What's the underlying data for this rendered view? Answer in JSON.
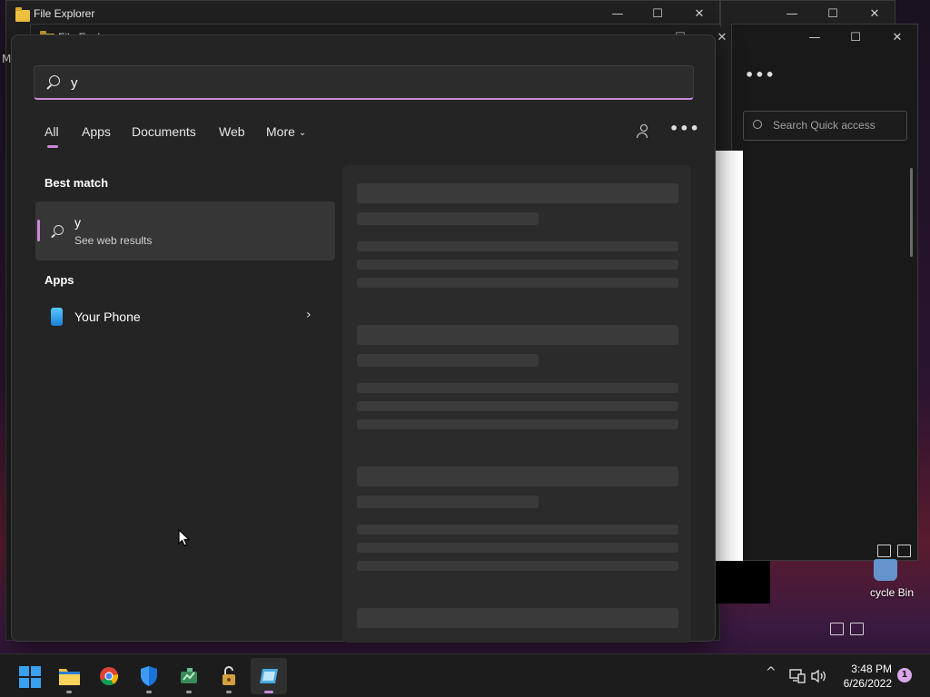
{
  "background": {
    "window1_title": "File Explorer",
    "window2_title": "File Explorer",
    "quick_access_placeholder": "Search Quick access",
    "recycle_bin_label": "cycle Bin",
    "edge_letter": "M"
  },
  "search": {
    "query": "y"
  },
  "tabs": [
    {
      "label": "All"
    },
    {
      "label": "Apps"
    },
    {
      "label": "Documents"
    },
    {
      "label": "Web"
    },
    {
      "label": "More"
    }
  ],
  "best_match": {
    "heading": "Best match",
    "title": "y",
    "subtitle": "See web results"
  },
  "apps": {
    "heading": "Apps",
    "items": [
      {
        "label": "Your Phone"
      }
    ]
  },
  "taskbar": {
    "time": "3:48 PM",
    "date": "6/26/2022",
    "notification_count": "1"
  },
  "colors": {
    "accent": "#c98ad8",
    "flyout_bg": "#242424",
    "taskbar_bg": "#1c1c1c"
  }
}
